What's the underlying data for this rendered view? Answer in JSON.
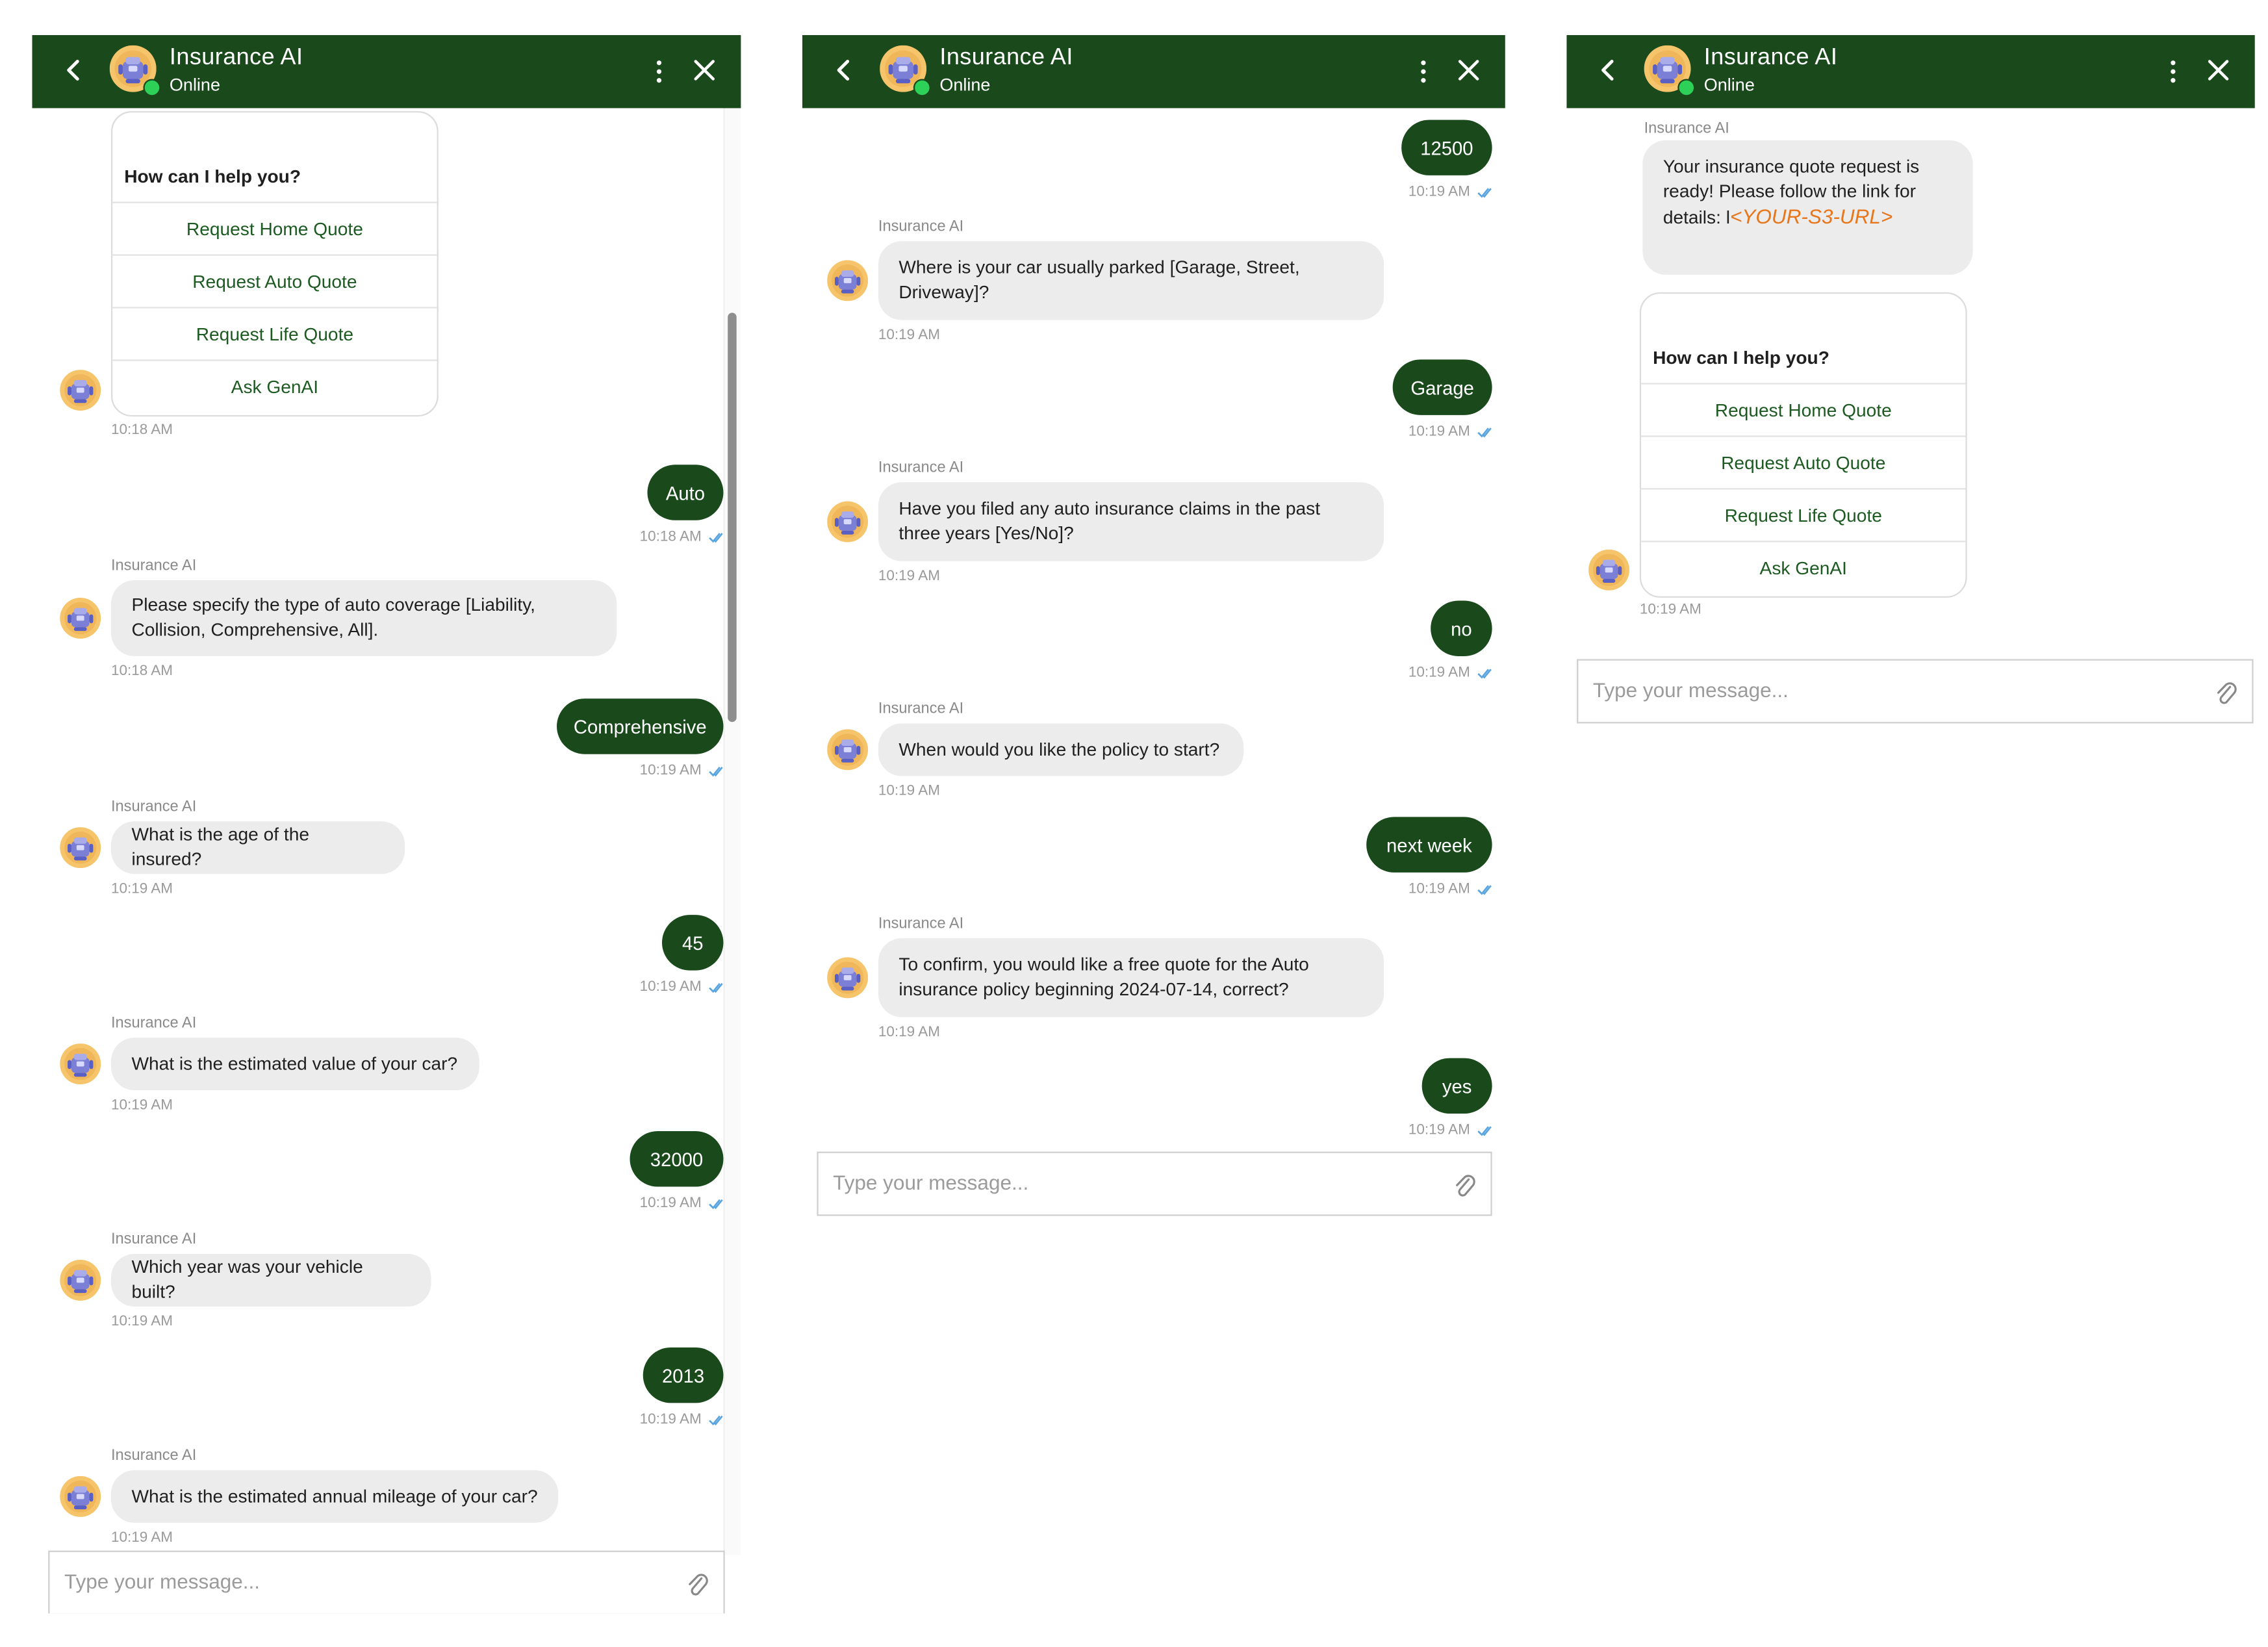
{
  "app": {
    "title": "Insurance AI",
    "status": "Online",
    "bot_name": "Insurance AI"
  },
  "icons": [
    "back-arrow-icon",
    "bot-avatar-icon",
    "online-status-icon",
    "more-vertical-icon",
    "close-icon",
    "read-receipt-icon",
    "paperclip-icon"
  ],
  "colors": {
    "header": "#1a4a1c",
    "user_bubble": "#1a4a1c",
    "bot_bubble": "#ececec",
    "option_text": "#1d5a22",
    "online": "#2ed158",
    "link": "#e8761b",
    "read_ticks": "#5aa5e0"
  },
  "menu": {
    "title": "How can I help you?",
    "options": [
      "Request Home Quote",
      "Request Auto Quote",
      "Request Life Quote",
      "Ask GenAI"
    ]
  },
  "input": {
    "placeholder": "Type your message..."
  },
  "panel1": {
    "menu_time": "10:18 AM",
    "messages": [
      {
        "from": "user",
        "text": "Auto",
        "time": "10:18 AM"
      },
      {
        "from": "bot",
        "text": "Please specify the type of auto coverage [Liability, Collision, Comprehensive, All].",
        "time": "10:18 AM"
      },
      {
        "from": "user",
        "text": "Comprehensive",
        "time": "10:19 AM"
      },
      {
        "from": "bot",
        "text": "What is the age of the insured?",
        "time": "10:19 AM"
      },
      {
        "from": "user",
        "text": "45",
        "time": "10:19 AM"
      },
      {
        "from": "bot",
        "text": "What is the estimated value of your car?",
        "time": "10:19 AM"
      },
      {
        "from": "user",
        "text": "32000",
        "time": "10:19 AM"
      },
      {
        "from": "bot",
        "text": "Which year was your vehicle built?",
        "time": "10:19 AM"
      },
      {
        "from": "user",
        "text": "2013",
        "time": "10:19 AM"
      },
      {
        "from": "bot",
        "text": "What is the estimated annual mileage of your car?",
        "time": "10:19 AM"
      }
    ]
  },
  "panel2": {
    "messages": [
      {
        "from": "user",
        "text": "12500",
        "time": "10:19 AM"
      },
      {
        "from": "bot",
        "text": "Where is your car usually parked [Garage, Street, Driveway]?",
        "time": "10:19 AM"
      },
      {
        "from": "user",
        "text": "Garage",
        "time": "10:19 AM"
      },
      {
        "from": "bot",
        "text": "Have you filed any auto insurance claims in the past three years [Yes/No]?",
        "time": "10:19 AM"
      },
      {
        "from": "user",
        "text": "no",
        "time": "10:19 AM"
      },
      {
        "from": "bot",
        "text": "When would you like the policy to start?",
        "time": "10:19 AM"
      },
      {
        "from": "user",
        "text": "next week",
        "time": "10:19 AM"
      },
      {
        "from": "bot",
        "text": "To confirm, you would like a free quote for the Auto insurance policy beginning 2024-07-14, correct?",
        "time": "10:19 AM"
      },
      {
        "from": "user",
        "text": "yes",
        "time": "10:19 AM"
      }
    ]
  },
  "panel3": {
    "quote_text": "Your insurance quote request is ready! Please follow the link for details: l",
    "quote_link": "<YOUR-S3-URL>",
    "menu_time": "10:19 AM"
  }
}
